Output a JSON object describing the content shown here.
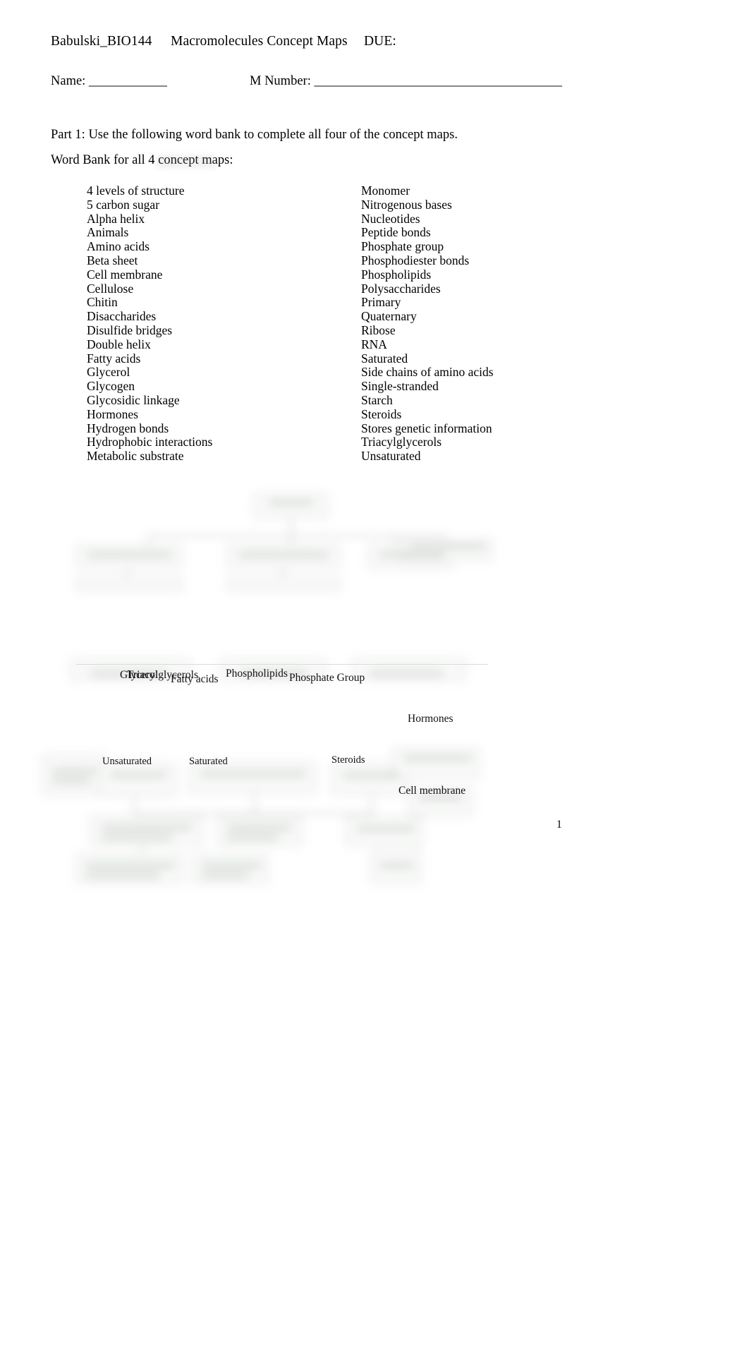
{
  "document": {
    "header": {
      "course": "Babulski_BIO144",
      "title": "Macromolecules Concept Maps",
      "due": "DUE:"
    },
    "fields": {
      "name_label": "Name: ____________",
      "mnumber_label": "M Number: ______________________________________"
    },
    "part1_instruction": "Part 1: Use the following word bank to complete all four of the concept maps.",
    "wordbank_heading": "Word Bank for all 4 concept maps:",
    "wordbank": {
      "left_column": [
        "4 levels of structure",
        "5 carbon sugar",
        "Alpha helix",
        "Animals",
        "Amino acids",
        "Beta sheet",
        "Cell membrane",
        "Cellulose",
        "Chitin",
        "Disaccharides",
        "Disulfide bridges",
        "Double helix",
        "Fatty acids",
        "Glycerol",
        "Glycogen",
        "Glycosidic linkage",
        "Hormones",
        "Hydrogen bonds",
        "Hydrophobic interactions",
        "Metabolic substrate"
      ],
      "right_column": [
        "Monomer",
        "Nitrogenous bases",
        "Nucleotides",
        "Peptide bonds",
        "Phosphate group",
        "Phosphodiester bonds",
        "Phospholipids",
        "Polysaccharides",
        "Primary",
        "Quaternary",
        "Ribose",
        "RNA",
        "Saturated",
        "Side chains of amino acids",
        "Single-stranded",
        "Starch",
        "Steroids",
        "Stores genetic information",
        "Triacylglycerols",
        "Unsaturated"
      ]
    },
    "concept_map_labels": {
      "glycerol": "Glycerol",
      "triacylglycerols": "Triacylglycerols",
      "fatty_acids": "Fatty acids",
      "phospholipids": "Phospholipids",
      "phosphate_group": "Phosphate Group",
      "hormones": "Hormones",
      "unsaturated": "Unsaturated",
      "saturated": "Saturated",
      "steroids": "Steroids",
      "cell_membrane": "Cell membrane"
    },
    "page_number": "1"
  }
}
